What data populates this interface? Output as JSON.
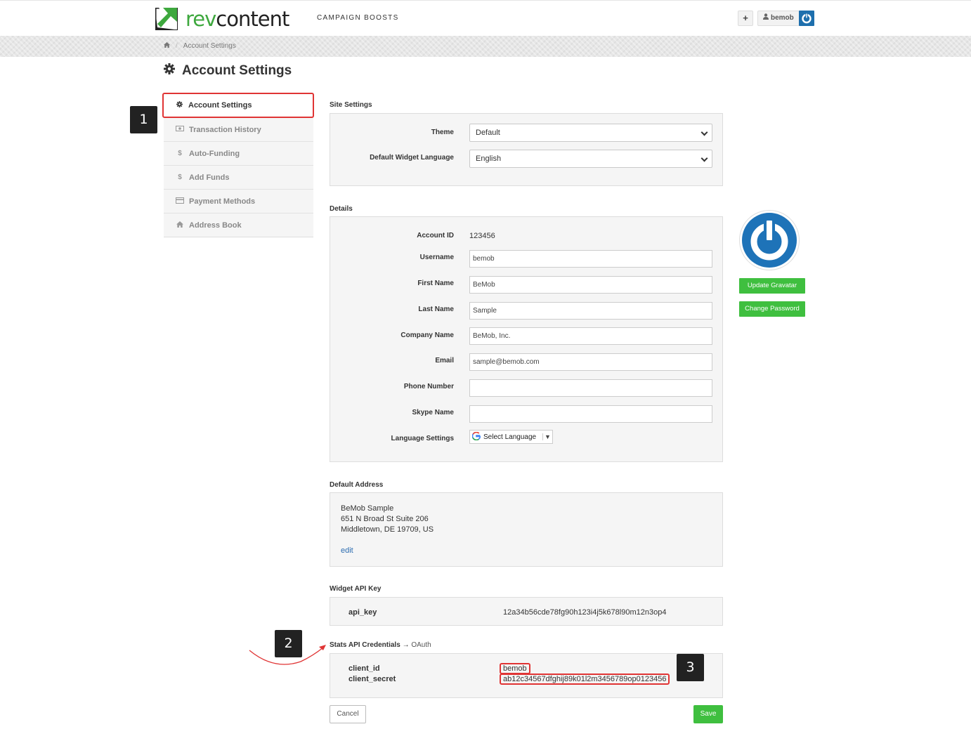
{
  "header": {
    "logo_rev": "rev",
    "logo_content": "content",
    "nav_link": "CAMPAIGN BOOSTS",
    "plus_label": "+",
    "username": "bemob"
  },
  "breadcrumb": {
    "current": "Account Settings"
  },
  "page_title": "Account Settings",
  "sidebar": {
    "items": [
      {
        "label": "Account Settings",
        "icon": "gear-icon"
      },
      {
        "label": "Transaction History",
        "icon": "money-icon"
      },
      {
        "label": "Auto-Funding",
        "icon": "dollar-icon"
      },
      {
        "label": "Add Funds",
        "icon": "dollar-icon"
      },
      {
        "label": "Payment Methods",
        "icon": "credit-card-icon"
      },
      {
        "label": "Address Book",
        "icon": "home-icon"
      }
    ]
  },
  "badges": {
    "b1": "1",
    "b2": "2",
    "b3": "3"
  },
  "site_settings": {
    "title": "Site Settings",
    "theme_label": "Theme",
    "theme_value": "Default",
    "lang_label": "Default Widget Language",
    "lang_value": "English"
  },
  "details": {
    "title": "Details",
    "account_id_label": "Account ID",
    "account_id": "123456",
    "username_label": "Username",
    "username": "bemob",
    "first_name_label": "First Name",
    "first_name": "BeMob",
    "last_name_label": "Last Name",
    "last_name": "Sample",
    "company_label": "Company Name",
    "company": "BeMob, Inc.",
    "email_label": "Email",
    "email": "sample@bemob.com",
    "phone_label": "Phone Number",
    "phone": "",
    "skype_label": "Skype Name",
    "skype": "",
    "language_settings_label": "Language Settings",
    "select_language": "Select Language"
  },
  "gravatar": {
    "update_label": "Update Gravatar",
    "password_label": "Change Password"
  },
  "address": {
    "title": "Default Address",
    "line1": "BeMob Sample",
    "line2": "651 N Broad St Suite 206",
    "line3": "Middletown, DE 19709, US",
    "edit": "edit"
  },
  "widget_api": {
    "title": "Widget API Key",
    "key_label": "api_key",
    "key_value": "12a34b56cde78fg90h123i4j5k678l90m12n3op4"
  },
  "stats_api": {
    "title": "Stats API Credentials",
    "arrow": "→",
    "subtitle": "OAuth",
    "client_id_label": "client_id",
    "client_id": "bemob",
    "client_secret_label": "client_secret",
    "client_secret": "ab12c34567dfghij89k01l2m3456789op0123456"
  },
  "actions": {
    "cancel": "Cancel",
    "save": "Save"
  },
  "colors": {
    "brand_green": "#3ea83e",
    "button_green": "#3fbf3f",
    "highlight_red": "#e03434",
    "avatar_blue": "#1e6fad"
  }
}
